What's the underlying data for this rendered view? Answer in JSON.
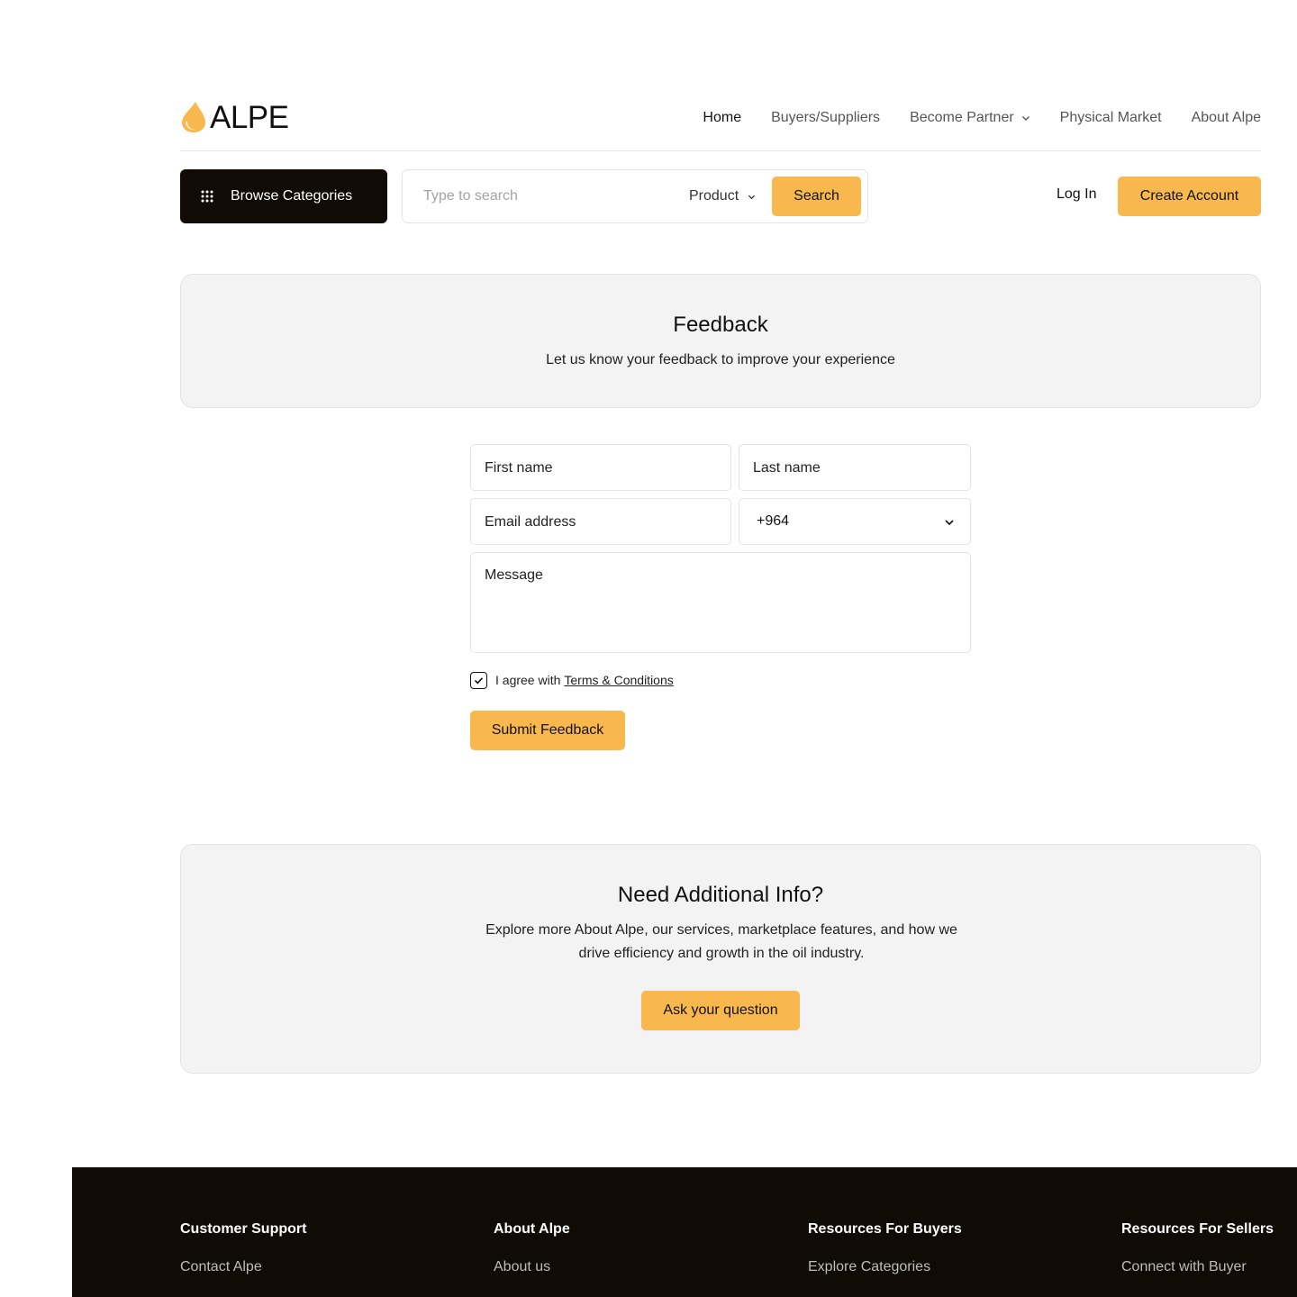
{
  "brand": {
    "name": "ALPE",
    "accent": "#F9B84D",
    "dark": "#110B06"
  },
  "nav": {
    "items": [
      {
        "label": "Home"
      },
      {
        "label": "Buyers/Suppliers"
      },
      {
        "label": "Become Partner"
      },
      {
        "label": "Physical Market"
      },
      {
        "label": "About Alpe"
      }
    ]
  },
  "toolbar": {
    "browse_label": "Browse Categories",
    "search_placeholder": "Type to search",
    "search_type": "Product",
    "search_button": "Search",
    "login_label": "Log In",
    "create_account_label": "Create Account"
  },
  "hero": {
    "title": "Feedback",
    "subtitle": "Let us know your feedback to improve your experience"
  },
  "form": {
    "first_name_placeholder": "First name",
    "last_name_placeholder": "Last name",
    "email_placeholder": "Email address",
    "phone_code": "+964",
    "message_placeholder": "Message",
    "agree_text": "I agree with",
    "terms_link": "Terms & Conditions",
    "agree_checked": true,
    "submit_label": "Submit Feedback"
  },
  "info": {
    "title": "Need Additional Info?",
    "body": "Explore more About Alpe, our services, marketplace features, and how we drive efficiency and growth in the oil industry.",
    "button_label": "Ask your question"
  },
  "footer": {
    "columns": [
      {
        "title": "Customer Support",
        "links": [
          "Contact Alpe"
        ]
      },
      {
        "title": "About Alpe",
        "links": [
          "About us"
        ]
      },
      {
        "title": "Resources For Buyers",
        "links": [
          "Explore Categories"
        ]
      },
      {
        "title": "Resources For Sellers",
        "links": [
          "Connect with Buyer"
        ]
      }
    ]
  }
}
